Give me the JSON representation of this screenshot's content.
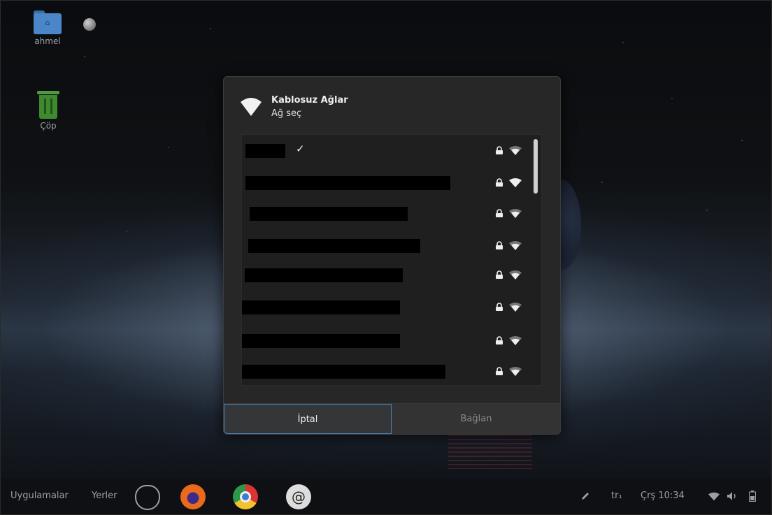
{
  "desktop": {
    "home_folder_label": "ahmel",
    "trash_label": "Çöp"
  },
  "dialog": {
    "title": "Kablosuz Ağlar",
    "subtitle": "Ağ seç",
    "icon": "wifi-icon",
    "networks": [
      {
        "name": "",
        "connected": true,
        "secured": true,
        "signal": "strong"
      },
      {
        "name": "",
        "connected": false,
        "secured": true,
        "signal": "excellent"
      },
      {
        "name": "",
        "connected": false,
        "secured": true,
        "signal": "strong"
      },
      {
        "name": "",
        "connected": false,
        "secured": true,
        "signal": "strong"
      },
      {
        "name": "",
        "connected": false,
        "secured": true,
        "signal": "strong"
      },
      {
        "name": "",
        "connected": false,
        "secured": true,
        "signal": "strong"
      },
      {
        "name": "",
        "connected": false,
        "secured": true,
        "signal": "strong"
      },
      {
        "name": "",
        "connected": false,
        "secured": true,
        "signal": "strong"
      }
    ],
    "connected_mark": "✓",
    "cancel_label": "İptal",
    "connect_label": "Bağlan",
    "connect_enabled": false
  },
  "taskbar": {
    "apps_label": "Uygulamalar",
    "places_label": "Yerler",
    "launchers": [
      "panther-icon",
      "firefox-icon",
      "chrome-icon",
      "mail-icon"
    ],
    "keyboard_layout": "tr₁",
    "clock": "Çrş 10:34",
    "tray_icons": [
      "pencil-icon",
      "wifi-icon",
      "volume-icon",
      "battery-icon"
    ]
  }
}
